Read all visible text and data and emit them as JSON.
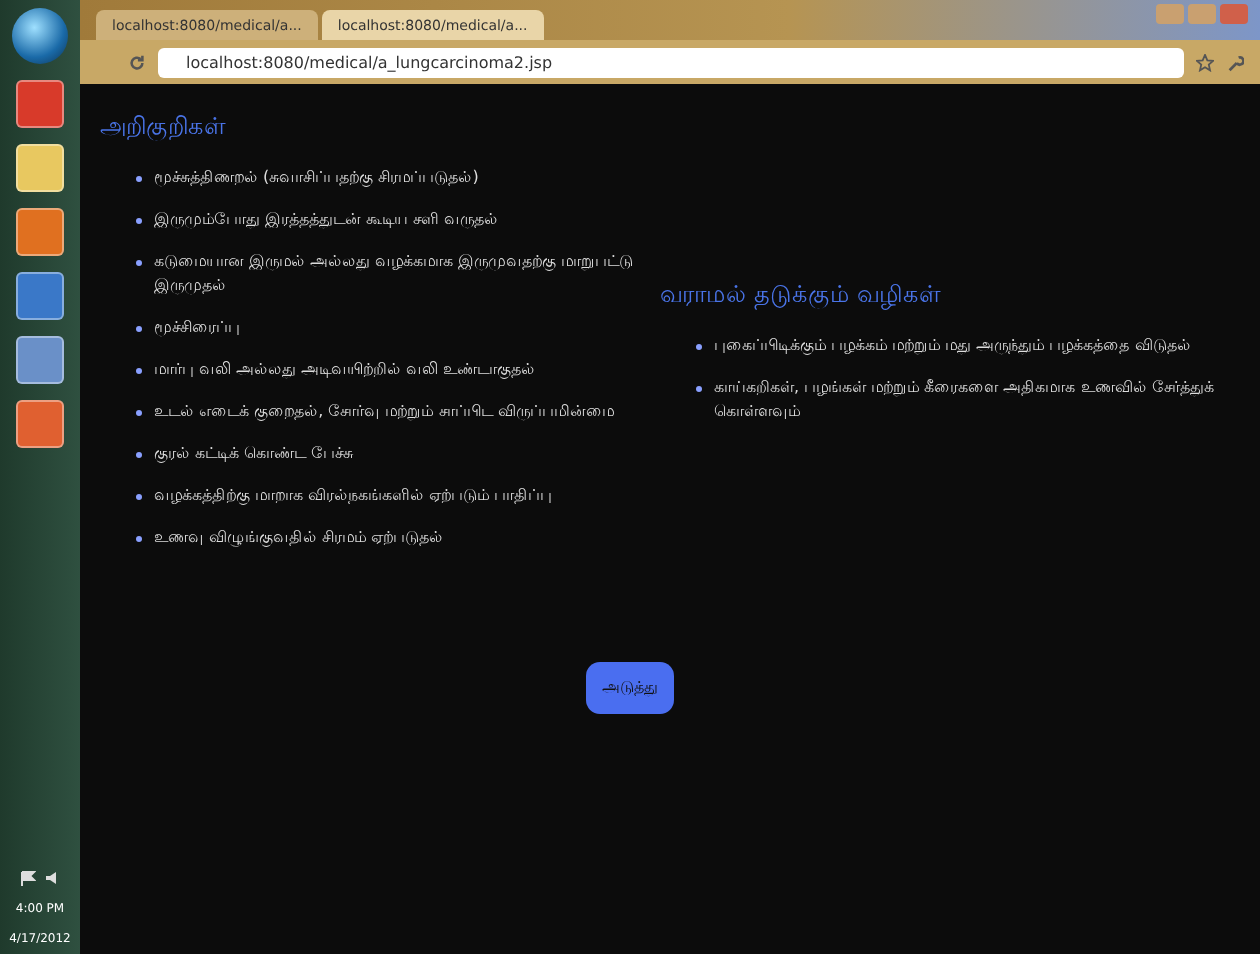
{
  "browser": {
    "tabs": [
      {
        "title": "localhost:8080/medical/a...",
        "selected": false
      },
      {
        "title": "localhost:8080/medical/a...",
        "selected": true
      }
    ],
    "url": "localhost:8080/medical/a_lungcarcinoma2.jsp"
  },
  "symptoms": {
    "heading": "அறிகுறிகள்",
    "items": [
      "மூச்சுத்திணறல் (சுவாசிப்பதற்கு சிரமப்படுதல்)",
      "இருமும்போது இரத்தத்துடன் கூடிய சளி வருதல்",
      "கடுமையான இருமல் அல்லது வழக்கமாக இருமுவதற்கு மாறுபட்டு இருமுதல்",
      "மூச்சிரைப்பு",
      "மார்பு வலி அல்லது அடிவயிற்றில் வலி உண்டாகுதல்",
      "உடல் எடைக் குறைதல், சோர்வு மற்றும் சாப்பிட விருப்பமின்மை",
      "குரல் கட்டிக் கொண்ட பேச்சு",
      "வழக்கத்திற்கு மாறாக விரல்நகங்களில் ஏற்படும் பாதிப்பு",
      "உணவு விழுங்குவதில் சிரமம் ஏற்படுதல்"
    ]
  },
  "prevention": {
    "heading": "வராமல் தடுக்கும் வழிகள்",
    "items": [
      "புகைப்பிடிக்கும் பழக்கம் மற்றும் மது அருந்தும் பழக்கத்தை விடுதல்",
      "காய்கறிகள், பழங்கள் மற்றும் கீரைகளை அதிகமாக உணவில் சேர்த்துக் கொள்ளவும்"
    ]
  },
  "next_button": "அடுத்து",
  "taskbar": {
    "time": "4:00 PM",
    "date": "4/17/2012"
  }
}
